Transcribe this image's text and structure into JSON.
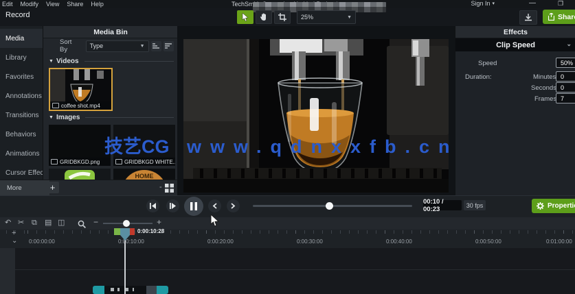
{
  "window": {
    "menu": [
      "Edit",
      "Modify",
      "View",
      "Share",
      "Help"
    ],
    "title": "TechSmith Camtasia - Untitled Project*",
    "sign_in": "Sign In",
    "record": "Record",
    "zoom_level": "25%",
    "share": "Share"
  },
  "sidebar": {
    "items": [
      {
        "label": "Media"
      },
      {
        "label": "Library"
      },
      {
        "label": "Favorites"
      },
      {
        "label": "Annotations"
      },
      {
        "label": "Transitions"
      },
      {
        "label": "Behaviors"
      },
      {
        "label": "Animations"
      },
      {
        "label": "Cursor Effec..."
      }
    ],
    "more_label": "More"
  },
  "media_bin": {
    "title": "Media Bin",
    "sort_label": "Sort By",
    "sort_value": "Type",
    "videos_header": "Videos",
    "images_header": "Images",
    "video_item": "coffee shot.mp4",
    "image_item_1": "GRIDBKGD.png",
    "image_item_2": "GRIDBKGD WHITE...",
    "home_thumb_text": "HOME"
  },
  "effects": {
    "title": "Effects",
    "effect_name": "Clip Speed",
    "speed_label": "Speed",
    "speed_value": "50%",
    "duration_label": "Duration:",
    "minutes_label": "Minutes",
    "minutes_value": "0",
    "seconds_label": "Seconds",
    "seconds_value": "0",
    "frames_label": "Frames",
    "frames_value": "7"
  },
  "playback": {
    "time_display": "00:10 / 00:23",
    "fps": "30 fps",
    "properties_label": "Properties"
  },
  "timeline": {
    "playhead_time": "0:00:10:28",
    "ruler_labels": [
      "0:00:00:00",
      "0:00:10:00",
      "0:00:20:00",
      "0:00:30:00",
      "0:00:40:00",
      "0:00:50:00",
      "0:01:00:00"
    ]
  },
  "watermark": {
    "cn": "技艺CG",
    "url": "www.qdnxxfb.cn",
    "color": "#2b5ccd"
  }
}
